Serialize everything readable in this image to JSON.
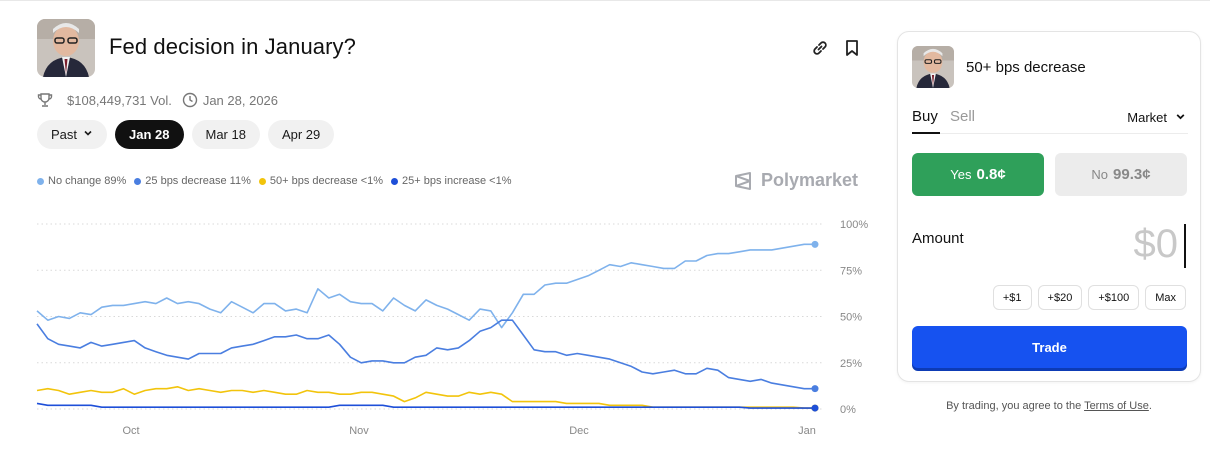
{
  "header": {
    "title": "Fed decision in January?",
    "volume": "$108,449,731 Vol.",
    "end_date": "Jan 28, 2026",
    "link_icon": "link-icon",
    "bookmark_icon": "bookmark-icon",
    "trophy_icon": "trophy-icon",
    "clock_icon": "clock-icon"
  },
  "date_tabs": [
    {
      "label": "Past",
      "active": false,
      "dropdown": true
    },
    {
      "label": "Jan 28",
      "active": true
    },
    {
      "label": "Mar 18",
      "active": false
    },
    {
      "label": "Apr 29",
      "active": false
    }
  ],
  "legend": [
    {
      "label": "No change 89%",
      "color": "#7fb2ec"
    },
    {
      "label": "25 bps decrease 11%",
      "color": "#4a7ee0"
    },
    {
      "label": "50+ bps decrease <1%",
      "color": "#f2c40c"
    },
    {
      "label": "25+ bps increase <1%",
      "color": "#1e4fd8"
    }
  ],
  "watermark": "Polymarket",
  "chart_data": {
    "type": "line",
    "x_tick_labels": [
      "Oct",
      "Nov",
      "Dec",
      "Jan"
    ],
    "y_tick_labels": [
      "100%",
      "75%",
      "50%",
      "25%",
      "0%"
    ],
    "ylim": [
      0,
      100
    ],
    "grid": true,
    "legend_position": "top-left",
    "series": [
      {
        "name": "No change",
        "color": "#7fb2ec",
        "values": [
          53,
          48,
          50,
          49,
          52,
          51,
          55,
          56,
          56,
          57,
          58,
          57,
          60,
          57,
          58,
          57,
          54,
          52,
          58,
          55,
          52,
          57,
          57,
          53,
          54,
          52,
          65,
          60,
          62,
          58,
          57,
          57,
          53,
          60,
          56,
          53,
          59,
          56,
          54,
          51,
          48,
          54,
          53,
          44,
          52,
          62,
          62,
          67,
          68,
          68,
          70,
          72,
          75,
          78,
          77,
          79,
          78,
          77,
          76,
          76,
          80,
          80,
          83,
          84,
          84,
          85,
          86,
          86,
          86,
          87,
          88,
          89,
          89
        ]
      },
      {
        "name": "25 bps decrease",
        "color": "#4a7ee0",
        "values": [
          46,
          38,
          35,
          34,
          33,
          36,
          34,
          35,
          36,
          37,
          33,
          31,
          29,
          28,
          27,
          30,
          30,
          30,
          33,
          34,
          35,
          37,
          39,
          39,
          40,
          38,
          38,
          40,
          35,
          28,
          25,
          26,
          26,
          25,
          25,
          28,
          29,
          33,
          32,
          33,
          37,
          42,
          44,
          48,
          48,
          40,
          32,
          31,
          31,
          29,
          30,
          29,
          28,
          27,
          25,
          23,
          20,
          19,
          20,
          21,
          19,
          19,
          22,
          21,
          17,
          16,
          15,
          16,
          14,
          13,
          12,
          11,
          11
        ]
      },
      {
        "name": "50+ bps decrease",
        "color": "#f2c40c",
        "values": [
          10,
          11,
          10,
          8,
          9,
          10,
          9,
          9,
          11,
          8,
          10,
          11,
          11,
          12,
          10,
          11,
          10,
          9,
          10,
          10,
          9,
          10,
          9,
          8,
          8,
          10,
          9,
          9,
          8,
          8,
          9,
          9,
          8,
          7,
          4,
          6,
          9,
          8,
          7,
          7,
          9,
          8,
          9,
          8,
          4,
          4,
          4,
          4,
          4,
          3,
          3,
          3,
          3,
          2,
          2,
          2,
          2,
          1,
          1,
          1,
          1,
          1,
          1,
          1,
          1,
          1,
          1,
          1,
          1,
          1,
          1,
          0.5,
          0.5
        ]
      },
      {
        "name": "25+ bps increase",
        "color": "#1e4fd8",
        "values": [
          3,
          2,
          2,
          2,
          2,
          2,
          1,
          1,
          1,
          1,
          1,
          1,
          1,
          1,
          1,
          1,
          1,
          1,
          1,
          1,
          1,
          1,
          1,
          1,
          1,
          1,
          1,
          1,
          2,
          2,
          2,
          2,
          2,
          1,
          1,
          1,
          1,
          1,
          1,
          1,
          1,
          1,
          1,
          1,
          1,
          1,
          1,
          1,
          1,
          1,
          1,
          1,
          1,
          1,
          1,
          1,
          1,
          1,
          1,
          1,
          1,
          1,
          1,
          1,
          1,
          1,
          0.5,
          0.5,
          0.5,
          0.5,
          0.5,
          0.5,
          0.5
        ]
      }
    ]
  },
  "trade_panel": {
    "outcome_title": "50+ bps decrease",
    "tabs": [
      "Buy",
      "Sell"
    ],
    "order_type": "Market",
    "yes_label": "Yes",
    "yes_price": "0.8¢",
    "no_label": "No",
    "no_price": "99.3¢",
    "amount_label": "Amount",
    "amount_value": "$0",
    "quick_amounts": [
      "+$1",
      "+$20",
      "+$100",
      "Max"
    ],
    "trade_button": "Trade"
  },
  "footer": {
    "terms_prefix": "By trading, you agree to the ",
    "terms_link": "Terms of Use",
    "terms_suffix": "."
  }
}
